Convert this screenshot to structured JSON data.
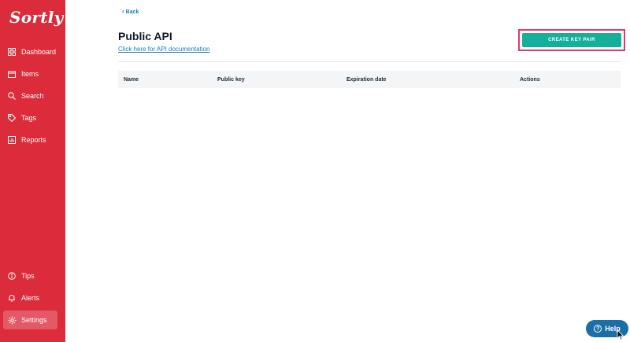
{
  "app": {
    "logo": "Sortly"
  },
  "sidebar": {
    "items": [
      {
        "label": "Dashboard",
        "icon": "dashboard-icon"
      },
      {
        "label": "Items",
        "icon": "items-icon"
      },
      {
        "label": "Search",
        "icon": "search-icon"
      },
      {
        "label": "Tags",
        "icon": "tag-icon"
      },
      {
        "label": "Reports",
        "icon": "reports-icon"
      }
    ],
    "bottom_items": [
      {
        "label": "Tips",
        "icon": "tips-icon"
      },
      {
        "label": "Alerts",
        "icon": "bell-icon"
      },
      {
        "label": "Settings",
        "icon": "gear-icon",
        "active": true
      }
    ]
  },
  "main": {
    "back_label": "Back",
    "title": "Public API",
    "doc_link": "Click here for API documentation",
    "create_button": "CREATE KEY PAIR",
    "table": {
      "columns": [
        "Name",
        "Public key",
        "Expiration date",
        "Actions"
      ],
      "rows": []
    }
  },
  "help": {
    "label": "Help"
  },
  "colors": {
    "sidebar": "#dc2b3b",
    "accent": "#14b09b",
    "link": "#1a7fb0",
    "highlight": "#e0396a",
    "help": "#1b6fa8"
  }
}
